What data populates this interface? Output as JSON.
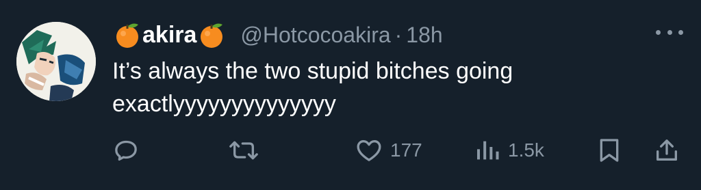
{
  "author": {
    "display_name": "akira",
    "handle": "@Hotcocoakira",
    "time": "18h",
    "separator": "·",
    "name_emoji": "orange-emoji"
  },
  "tweet": {
    "text": "It’s always the two stupid bitches going exactlyyyyyyyyyyyyyy"
  },
  "actions": {
    "reply": {
      "icon": "reply-icon"
    },
    "retweet": {
      "icon": "retweet-icon"
    },
    "like": {
      "icon": "heart-icon",
      "count": "177"
    },
    "views": {
      "icon": "views-icon",
      "count": "1.5k"
    },
    "bookmark": {
      "icon": "bookmark-icon"
    },
    "share": {
      "icon": "share-icon"
    }
  },
  "colors": {
    "background": "#15202b",
    "primary_text": "#ffffff",
    "secondary_text": "#8b98a5"
  }
}
